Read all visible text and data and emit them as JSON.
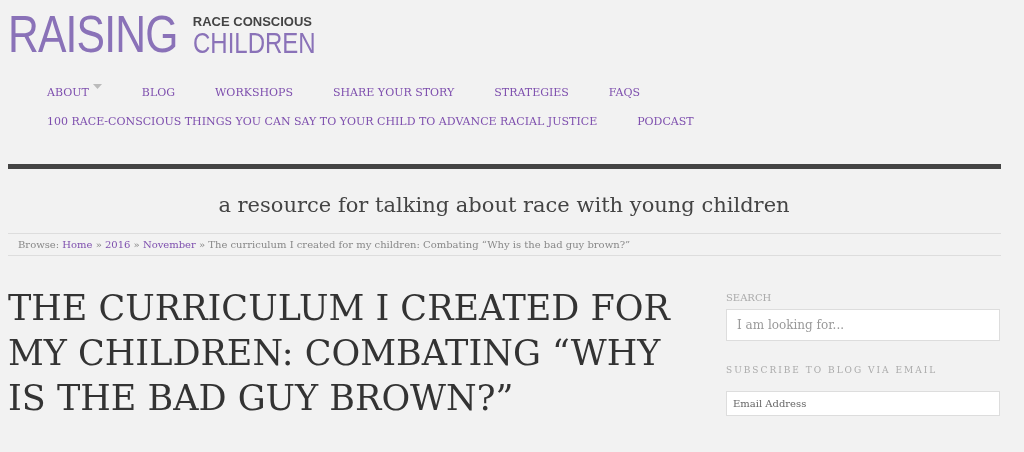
{
  "logo": {
    "big": "RAISING",
    "top": "RACE CONSCIOUS",
    "bottom": "CHILDREN"
  },
  "nav": [
    [
      {
        "label": "ABOUT",
        "has_dropdown": true
      },
      {
        "label": "BLOG",
        "has_dropdown": false
      },
      {
        "label": "WORKSHOPS",
        "has_dropdown": false
      },
      {
        "label": "SHARE YOUR STORY",
        "has_dropdown": false
      },
      {
        "label": "STRATEGIES",
        "has_dropdown": false
      },
      {
        "label": "FAQS",
        "has_dropdown": false
      }
    ],
    [
      {
        "label": "100 RACE-CONSCIOUS THINGS YOU CAN SAY TO YOUR CHILD TO ADVANCE RACIAL JUSTICE",
        "has_dropdown": false
      },
      {
        "label": "PODCAST",
        "has_dropdown": false
      }
    ]
  ],
  "tagline": "a resource for talking about race with young children",
  "breadcrumb": {
    "prefix": "Browse:",
    "links": [
      "Home",
      "2016",
      "November"
    ],
    "separator": "»",
    "current": "The curriculum I created for my children: Combating “Why is the bad guy brown?”"
  },
  "post_title": "THE CURRICULUM I CREATED FOR MY CHILDREN: COMBATING “WHY IS THE BAD GUY BROWN?”",
  "sidebar": {
    "search_heading": "SEARCH",
    "search_placeholder": "I am looking for...",
    "subscribe_heading": "SUBSCRIBE TO BLOG VIA EMAIL",
    "email_placeholder": "Email Address"
  }
}
